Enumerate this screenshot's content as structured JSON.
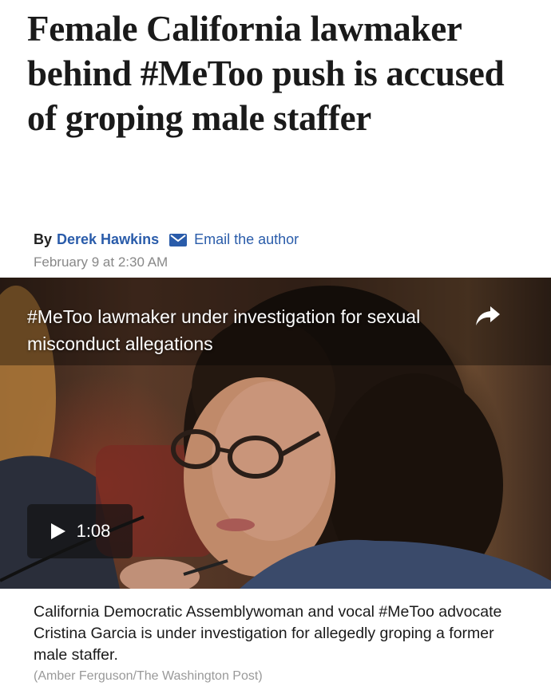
{
  "article": {
    "headline": "Female California lawmaker behind #MeToo push is accused of groping male staffer",
    "by_prefix": "By",
    "author": "Derek Hawkins",
    "email_link": "Email the author",
    "date": "February 9 at 2:30 AM"
  },
  "video": {
    "title": "#MeToo lawmaker under investigation for sexual misconduct allegations",
    "duration": "1:08",
    "share_icon": "share-arrow-icon",
    "play_icon": "play-icon"
  },
  "caption": {
    "text": "California Democratic Assemblywoman and vocal #MeToo advocate Cristina Garcia is under investigation for allegedly groping a former male staffer.",
    "credit": "(Amber Ferguson/The Washington Post)"
  },
  "colors": {
    "link": "#2a5caa",
    "headline": "#1a1a1a",
    "meta_gray": "#888888"
  }
}
